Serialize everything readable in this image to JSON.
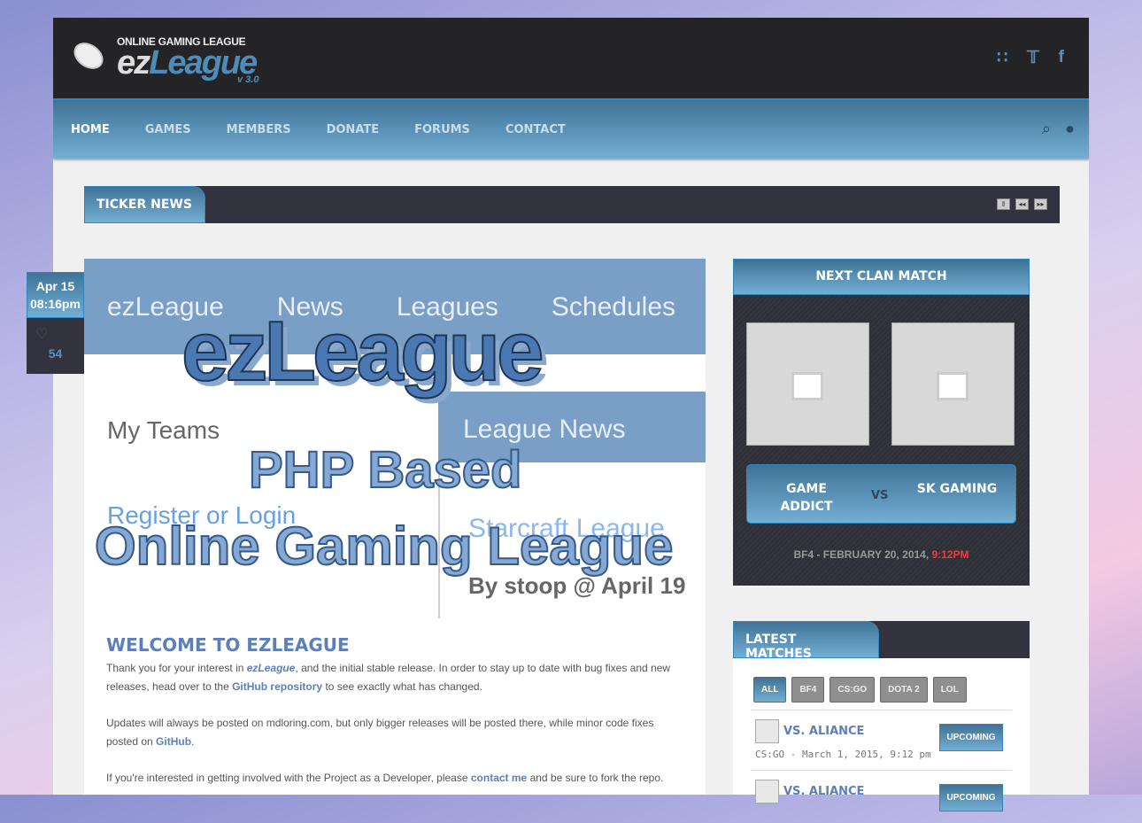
{
  "header": {
    "tagline": "ONLINE GAMING LEAGUE",
    "logo_ez": "ez",
    "logo_league": "League",
    "version": "v 3.0",
    "social": [
      "rss-icon",
      "twitter-icon",
      "facebook-icon"
    ]
  },
  "nav": {
    "items": [
      "HOME",
      "GAMES",
      "MEMBERS",
      "DONATE",
      "FORUMS",
      "CONTACT"
    ],
    "active": "HOME"
  },
  "ticker": {
    "label": "TICKER NEWS"
  },
  "post_date": {
    "date": "Apr 15",
    "time": "08:16pm",
    "likes": "54"
  },
  "hero": {
    "menu": [
      "ezLeague",
      "News",
      "Leagues",
      "Schedules"
    ],
    "my_teams": "My Teams",
    "league_news": "League News",
    "register": "Register or Login",
    "starcraft": "Starcraft League",
    "by": "By stoop @ April 19",
    "title": "ezLeague",
    "subtitle": "PHP Based",
    "tagline": "Online Gaming League"
  },
  "welcome": {
    "title": "WELCOME TO EZLEAGUE",
    "p1a": "Thank you for your interest in ",
    "p1link": "ezLeague",
    "p1b": ", and the initial stable release. In order to stay up to date with bug fixes and new releases, head over to the ",
    "p1link2": "GitHub repository",
    "p1c": " to see exactly what has changed.",
    "p2a": "Updates will always be posted on mdloring.com, but only bigger releases will be posted there, while minor code fixes posted on ",
    "p2link": "GitHub",
    "p2b": ".",
    "p3a": "If you're interested in getting involved with the Project as a Developer, please ",
    "p3link": "contact me",
    "p3b": " and be sure to fork the repo."
  },
  "next_match": {
    "title": "NEXT CLAN MATCH",
    "team1": "GAME ADDICT",
    "vs": "VS",
    "team2": "SK GAMING",
    "info": "BF4 - FEBRUARY 20, 2014, ",
    "time": "9:12PM"
  },
  "latest": {
    "title": "LATEST MATCHES",
    "filters": [
      "ALL",
      "BF4",
      "CS:GO",
      "DOTA 2",
      "LOL"
    ],
    "matches": [
      {
        "opponent": "VS. ALIANCE",
        "meta": "CS:GO - March 1, 2015, 9:12 pm",
        "status": "UPCOMING"
      },
      {
        "opponent": "VS. ALIANCE",
        "meta": "",
        "status": "UPCOMING"
      }
    ]
  }
}
